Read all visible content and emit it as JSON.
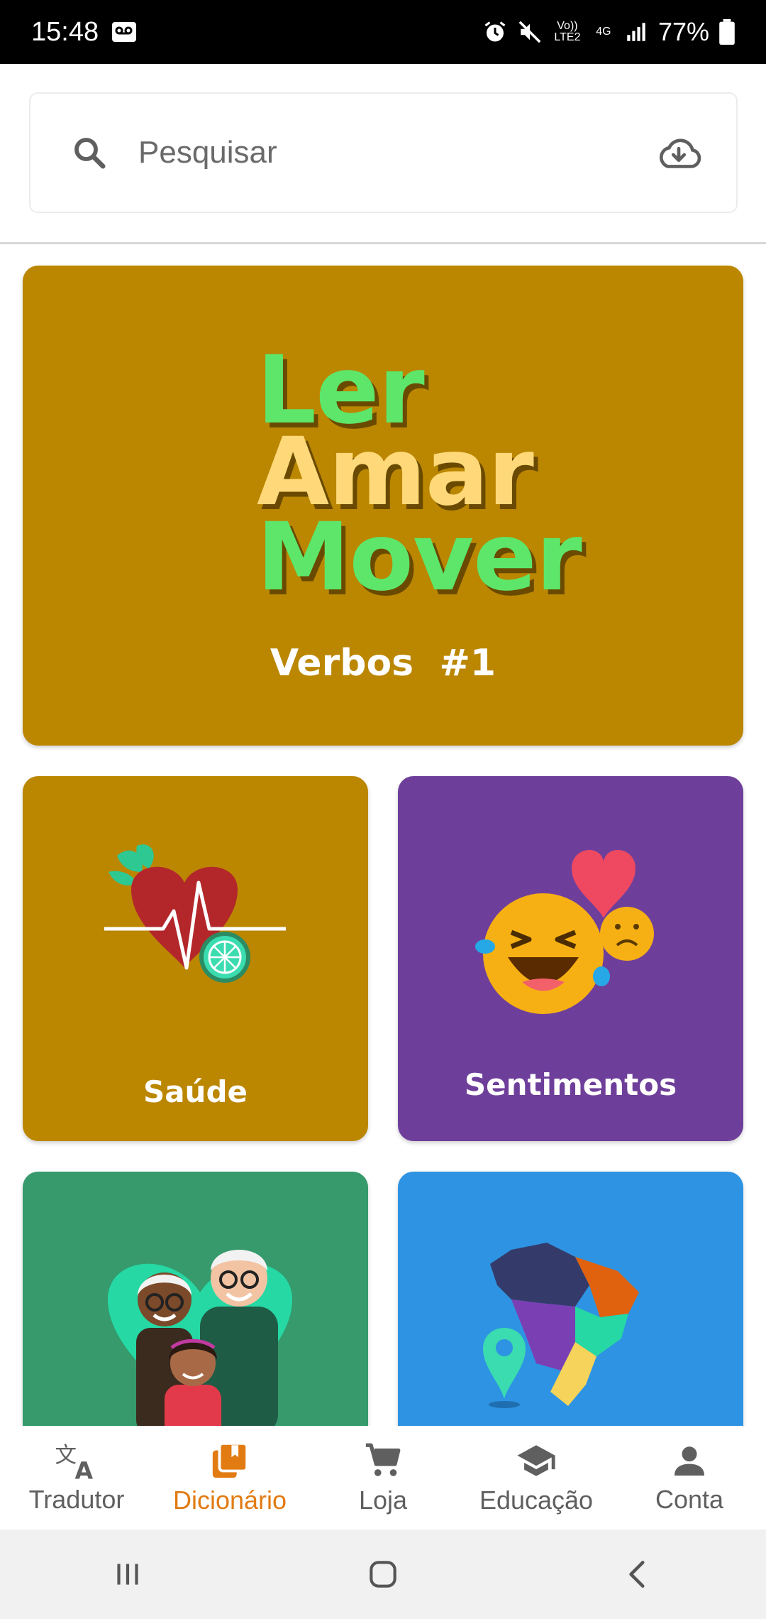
{
  "status": {
    "time": "15:48",
    "battery": "77%",
    "network": "4G",
    "volte": "Vo)) LTE2"
  },
  "search": {
    "placeholder": "Pesquisar"
  },
  "hero": {
    "line1": "Ler",
    "line2": "Amar",
    "line3": "Mover",
    "subtitle": "Verbos  #1"
  },
  "tiles": [
    {
      "label": "Saúde",
      "color": "#bb8600",
      "icon": "heart-health-icon"
    },
    {
      "label": "Sentimentos",
      "color": "#6e3f9a",
      "icon": "emoji-feelings-icon"
    },
    {
      "label": "",
      "color": "#369a6c",
      "icon": "family-icon"
    },
    {
      "label": "",
      "color": "#2e93e2",
      "icon": "brazil-map-icon"
    }
  ],
  "nav": {
    "items": [
      {
        "label": "Tradutor",
        "icon": "translate-icon"
      },
      {
        "label": "Dicionário",
        "icon": "dictionary-icon",
        "active": true
      },
      {
        "label": "Loja",
        "icon": "cart-icon"
      },
      {
        "label": "Educação",
        "icon": "school-icon"
      },
      {
        "label": "Conta",
        "icon": "person-icon"
      }
    ]
  },
  "colors": {
    "accent": "#e27b12",
    "hero_bg": "#bb8600"
  }
}
